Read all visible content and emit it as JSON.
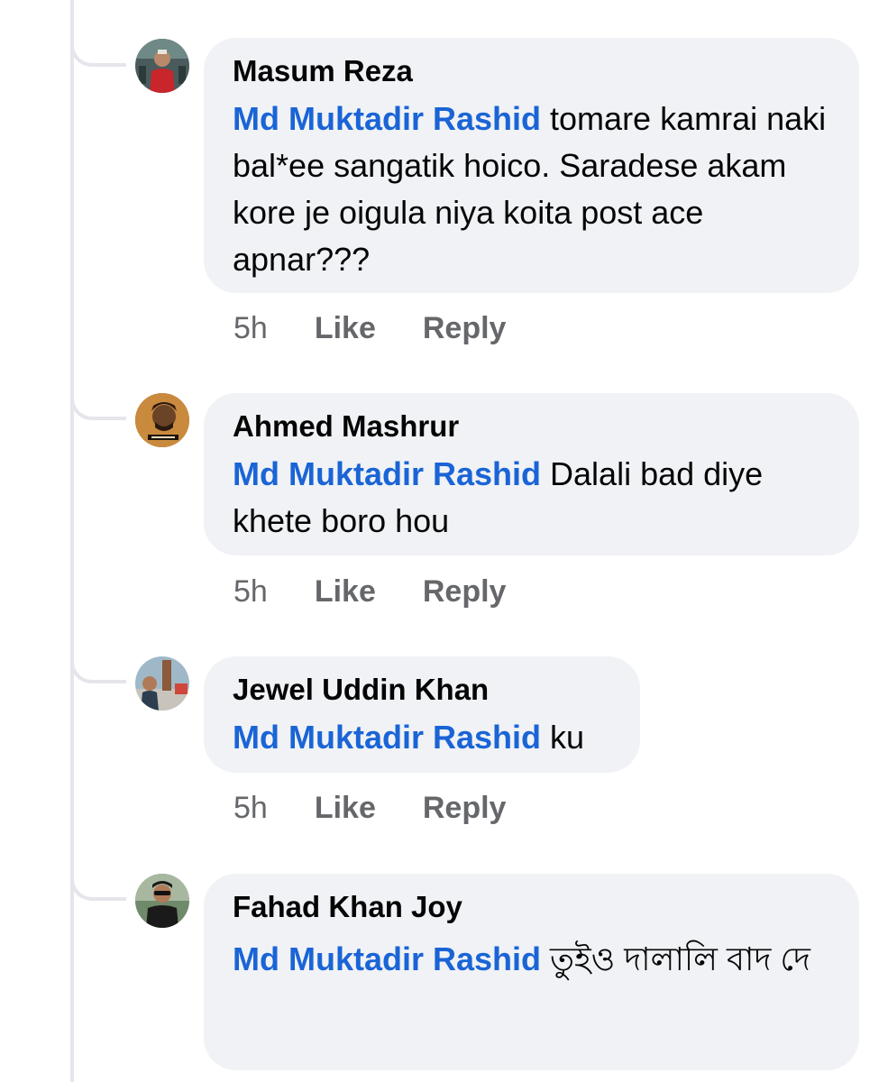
{
  "comments": [
    {
      "author": "Masum Reza",
      "mention": "Md Muktadir Rashid",
      "text": " tomare kamrai naki bal*ee sangatik hoico. Saradese akam kore je oigula niya koita post ace apnar???",
      "time": "5h",
      "like_label": "Like",
      "reply_label": "Reply"
    },
    {
      "author": "Ahmed Mashrur",
      "mention": "Md Muktadir Rashid",
      "text": " Dalali bad diye khete boro hou",
      "time": "5h",
      "like_label": "Like",
      "reply_label": "Reply"
    },
    {
      "author": "Jewel Uddin Khan",
      "mention": "Md Muktadir Rashid",
      "text": " ku",
      "time": "5h",
      "like_label": "Like",
      "reply_label": "Reply"
    },
    {
      "author": "Fahad Khan Joy",
      "mention": "Md Muktadir Rashid",
      "text": " তুইও দালালি বাদ দে"
    }
  ],
  "colors": {
    "mention": "#1a64d6",
    "bubble": "#f0f2f5",
    "muted_text": "#65676b",
    "thread_line": "#e4e6eb"
  }
}
